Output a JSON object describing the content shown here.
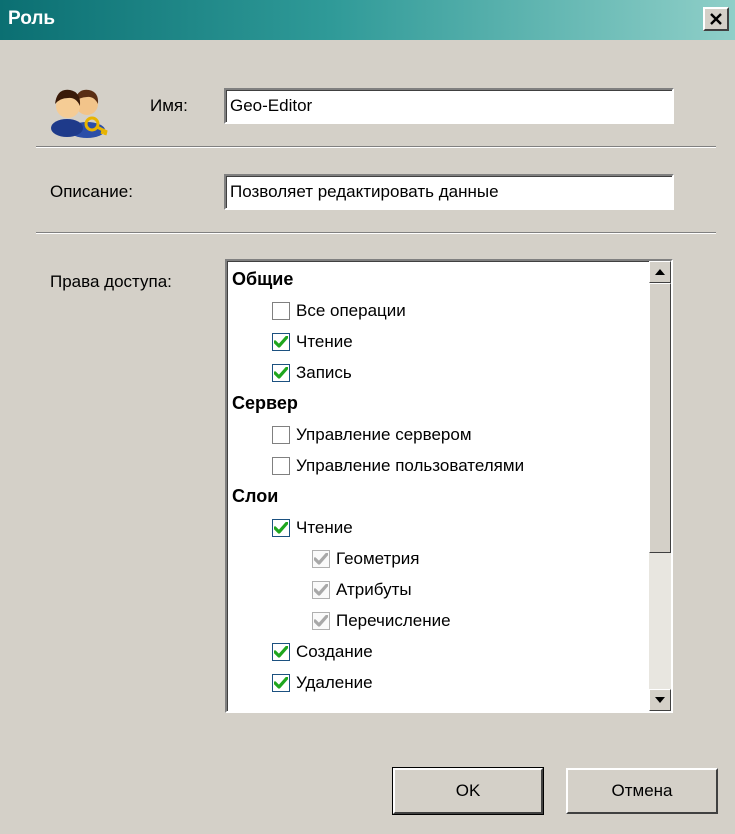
{
  "window": {
    "title": "Роль",
    "close_glyph": "✕"
  },
  "form": {
    "name_label": "Имя:",
    "name_value": "Geo-Editor",
    "description_label": "Описание:",
    "description_value": "Позволяет редактировать данные",
    "permissions_label": "Права доступа:"
  },
  "permissions": {
    "groups": [
      {
        "label": "Общие",
        "items": [
          {
            "label": "Все операции",
            "checked": false,
            "level": 1
          },
          {
            "label": "Чтение",
            "checked": true,
            "level": 1
          },
          {
            "label": "Запись",
            "checked": true,
            "level": 1
          }
        ]
      },
      {
        "label": "Сервер",
        "items": [
          {
            "label": "Управление сервером",
            "checked": false,
            "level": 1
          },
          {
            "label": "Управление пользователями",
            "checked": false,
            "level": 1
          }
        ]
      },
      {
        "label": "Слои",
        "items": [
          {
            "label": "Чтение",
            "checked": true,
            "level": 1
          },
          {
            "label": "Геометрия",
            "checked": true,
            "disabled": true,
            "level": 2
          },
          {
            "label": "Атрибуты",
            "checked": true,
            "disabled": true,
            "level": 2
          },
          {
            "label": "Перечисление",
            "checked": true,
            "disabled": true,
            "level": 2
          },
          {
            "label": "Создание",
            "checked": true,
            "level": 1
          },
          {
            "label": "Удаление",
            "checked": true,
            "level": 1
          }
        ]
      }
    ]
  },
  "buttons": {
    "ok_label": "OK",
    "cancel_label": "Отмена"
  },
  "icons": {
    "avatar": "users-key-icon",
    "scroll_up": "scroll-up-arrow-icon",
    "scroll_down": "scroll-down-arrow-icon"
  },
  "colors": {
    "check_mark": "#1fa61f",
    "check_mark_disabled": "#a8a8a8",
    "title_bar_start": "#0b6f72",
    "title_bar_end": "#8fcfc8"
  }
}
